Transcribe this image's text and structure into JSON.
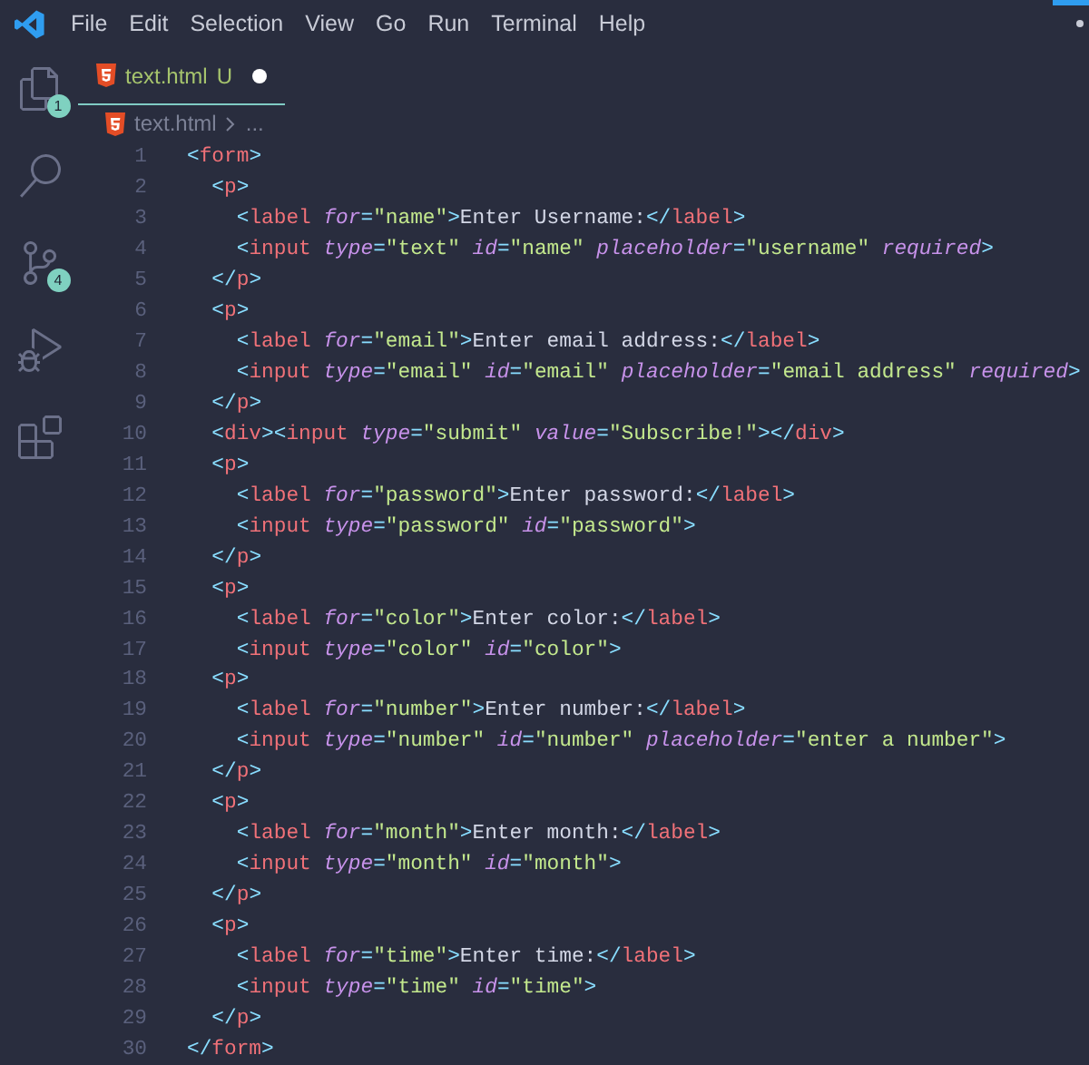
{
  "menu": [
    "File",
    "Edit",
    "Selection",
    "View",
    "Go",
    "Run",
    "Terminal",
    "Help"
  ],
  "activity_bar": [
    {
      "kind": "files",
      "badge": "1"
    },
    {
      "kind": "search"
    },
    {
      "kind": "source-control",
      "badge": "4"
    },
    {
      "kind": "run-debug"
    },
    {
      "kind": "extensions"
    }
  ],
  "tab": {
    "filename": "text.html",
    "status": "U",
    "modified": true,
    "selected": true
  },
  "breadcrumb": [
    "text.html",
    "..."
  ],
  "lines": [
    {
      "number": "1",
      "tokens": [
        {
          "kind": "punct",
          "text": "<"
        },
        {
          "kind": "tag",
          "text": "form"
        },
        {
          "kind": "punct",
          "text": ">"
        }
      ]
    },
    {
      "number": "2",
      "tokens": [
        {
          "kind": "punct",
          "text": "  <"
        },
        {
          "kind": "tag",
          "text": "p"
        },
        {
          "kind": "punct",
          "text": ">"
        }
      ]
    },
    {
      "number": "3",
      "tokens": [
        {
          "kind": "punct",
          "text": "    <"
        },
        {
          "kind": "tag",
          "text": "label"
        },
        {
          "kind": "attr",
          "text": " for"
        },
        {
          "kind": "punct",
          "text": "="
        },
        {
          "kind": "string",
          "text": "\"name\""
        },
        {
          "kind": "punct",
          "text": ">"
        },
        {
          "kind": "text",
          "text": "Enter Username:"
        },
        {
          "kind": "punct",
          "text": "</"
        },
        {
          "kind": "tag",
          "text": "label"
        },
        {
          "kind": "punct",
          "text": ">"
        }
      ]
    },
    {
      "number": "4",
      "tokens": [
        {
          "kind": "punct",
          "text": "    <"
        },
        {
          "kind": "tag",
          "text": "input"
        },
        {
          "kind": "attr",
          "text": " type"
        },
        {
          "kind": "punct",
          "text": "="
        },
        {
          "kind": "string",
          "text": "\"text\""
        },
        {
          "kind": "attr",
          "text": " id"
        },
        {
          "kind": "punct",
          "text": "="
        },
        {
          "kind": "string",
          "text": "\"name\""
        },
        {
          "kind": "attr",
          "text": " placeholder"
        },
        {
          "kind": "punct",
          "text": "="
        },
        {
          "kind": "string",
          "text": "\"username\""
        },
        {
          "kind": "attr",
          "text": " required"
        },
        {
          "kind": "punct",
          "text": ">"
        }
      ]
    },
    {
      "number": "5",
      "tokens": [
        {
          "kind": "punct",
          "text": "  </"
        },
        {
          "kind": "tag",
          "text": "p"
        },
        {
          "kind": "punct",
          "text": ">"
        }
      ]
    },
    {
      "number": "6",
      "tokens": [
        {
          "kind": "punct",
          "text": "  <"
        },
        {
          "kind": "tag",
          "text": "p"
        },
        {
          "kind": "punct",
          "text": ">"
        }
      ]
    },
    {
      "number": "7",
      "tokens": [
        {
          "kind": "punct",
          "text": "    <"
        },
        {
          "kind": "tag",
          "text": "label"
        },
        {
          "kind": "attr",
          "text": " for"
        },
        {
          "kind": "punct",
          "text": "="
        },
        {
          "kind": "string",
          "text": "\"email\""
        },
        {
          "kind": "punct",
          "text": ">"
        },
        {
          "kind": "text",
          "text": "Enter email address:"
        },
        {
          "kind": "punct",
          "text": "</"
        },
        {
          "kind": "tag",
          "text": "label"
        },
        {
          "kind": "punct",
          "text": ">"
        }
      ]
    },
    {
      "number": "8",
      "tokens": [
        {
          "kind": "punct",
          "text": "    <"
        },
        {
          "kind": "tag",
          "text": "input"
        },
        {
          "kind": "attr",
          "text": " type"
        },
        {
          "kind": "punct",
          "text": "="
        },
        {
          "kind": "string",
          "text": "\"email\""
        },
        {
          "kind": "attr",
          "text": " id"
        },
        {
          "kind": "punct",
          "text": "="
        },
        {
          "kind": "string",
          "text": "\"email\""
        },
        {
          "kind": "attr",
          "text": " placeholder"
        },
        {
          "kind": "punct",
          "text": "="
        },
        {
          "kind": "string",
          "text": "\"email address\""
        },
        {
          "kind": "attr",
          "text": " required"
        },
        {
          "kind": "punct",
          "text": ">"
        }
      ]
    },
    {
      "number": "9",
      "tokens": [
        {
          "kind": "punct",
          "text": "  </"
        },
        {
          "kind": "tag",
          "text": "p"
        },
        {
          "kind": "punct",
          "text": ">"
        }
      ]
    },
    {
      "number": "10",
      "tokens": [
        {
          "kind": "punct",
          "text": "  <"
        },
        {
          "kind": "tag",
          "text": "div"
        },
        {
          "kind": "punct",
          "text": "><"
        },
        {
          "kind": "tag",
          "text": "input"
        },
        {
          "kind": "attr",
          "text": " type"
        },
        {
          "kind": "punct",
          "text": "="
        },
        {
          "kind": "string",
          "text": "\"submit\""
        },
        {
          "kind": "attr",
          "text": " value"
        },
        {
          "kind": "punct",
          "text": "="
        },
        {
          "kind": "string",
          "text": "\"Subscribe!\""
        },
        {
          "kind": "punct",
          "text": "></"
        },
        {
          "kind": "tag",
          "text": "div"
        },
        {
          "kind": "punct",
          "text": ">"
        }
      ]
    },
    {
      "number": "11",
      "tokens": [
        {
          "kind": "punct",
          "text": "  <"
        },
        {
          "kind": "tag",
          "text": "p"
        },
        {
          "kind": "punct",
          "text": ">"
        }
      ]
    },
    {
      "number": "12",
      "tokens": [
        {
          "kind": "punct",
          "text": "    <"
        },
        {
          "kind": "tag",
          "text": "label"
        },
        {
          "kind": "attr",
          "text": " for"
        },
        {
          "kind": "punct",
          "text": "="
        },
        {
          "kind": "string",
          "text": "\"password\""
        },
        {
          "kind": "punct",
          "text": ">"
        },
        {
          "kind": "text",
          "text": "Enter password:"
        },
        {
          "kind": "punct",
          "text": "</"
        },
        {
          "kind": "tag",
          "text": "label"
        },
        {
          "kind": "punct",
          "text": ">"
        }
      ]
    },
    {
      "number": "13",
      "tokens": [
        {
          "kind": "punct",
          "text": "    <"
        },
        {
          "kind": "tag",
          "text": "input"
        },
        {
          "kind": "attr",
          "text": " type"
        },
        {
          "kind": "punct",
          "text": "="
        },
        {
          "kind": "string",
          "text": "\"password\""
        },
        {
          "kind": "attr",
          "text": " id"
        },
        {
          "kind": "punct",
          "text": "="
        },
        {
          "kind": "string",
          "text": "\"password\""
        },
        {
          "kind": "punct",
          "text": ">"
        }
      ]
    },
    {
      "number": "14",
      "tokens": [
        {
          "kind": "punct",
          "text": "  </"
        },
        {
          "kind": "tag",
          "text": "p"
        },
        {
          "kind": "punct",
          "text": ">"
        }
      ]
    },
    {
      "number": "15",
      "tokens": [
        {
          "kind": "punct",
          "text": "  <"
        },
        {
          "kind": "tag",
          "text": "p"
        },
        {
          "kind": "punct",
          "text": ">"
        }
      ]
    },
    {
      "number": "16",
      "tokens": [
        {
          "kind": "punct",
          "text": "    <"
        },
        {
          "kind": "tag",
          "text": "label"
        },
        {
          "kind": "attr",
          "text": " for"
        },
        {
          "kind": "punct",
          "text": "="
        },
        {
          "kind": "string",
          "text": "\"color\""
        },
        {
          "kind": "punct",
          "text": ">"
        },
        {
          "kind": "text",
          "text": "Enter color:"
        },
        {
          "kind": "punct",
          "text": "</"
        },
        {
          "kind": "tag",
          "text": "label"
        },
        {
          "kind": "punct",
          "text": ">"
        }
      ]
    },
    {
      "number": "17",
      "tokens": [
        {
          "kind": "punct",
          "text": "    <"
        },
        {
          "kind": "tag",
          "text": "input"
        },
        {
          "kind": "attr",
          "text": " type"
        },
        {
          "kind": "punct",
          "text": "="
        },
        {
          "kind": "string",
          "text": "\"color\""
        },
        {
          "kind": "attr",
          "text": " id"
        },
        {
          "kind": "punct",
          "text": "="
        },
        {
          "kind": "string",
          "text": "\"color\""
        },
        {
          "kind": "punct",
          "text": ">"
        }
      ]
    },
    {
      "number": "18",
      "tokens": [
        {
          "kind": "punct",
          "text": "  <"
        },
        {
          "kind": "tag",
          "text": "p"
        },
        {
          "kind": "punct",
          "text": ">"
        }
      ]
    },
    {
      "number": "19",
      "tokens": [
        {
          "kind": "punct",
          "text": "    <"
        },
        {
          "kind": "tag",
          "text": "label"
        },
        {
          "kind": "attr",
          "text": " for"
        },
        {
          "kind": "punct",
          "text": "="
        },
        {
          "kind": "string",
          "text": "\"number\""
        },
        {
          "kind": "punct",
          "text": ">"
        },
        {
          "kind": "text",
          "text": "Enter number:"
        },
        {
          "kind": "punct",
          "text": "</"
        },
        {
          "kind": "tag",
          "text": "label"
        },
        {
          "kind": "punct",
          "text": ">"
        }
      ]
    },
    {
      "number": "20",
      "tokens": [
        {
          "kind": "punct",
          "text": "    <"
        },
        {
          "kind": "tag",
          "text": "input"
        },
        {
          "kind": "attr",
          "text": " type"
        },
        {
          "kind": "punct",
          "text": "="
        },
        {
          "kind": "string",
          "text": "\"number\""
        },
        {
          "kind": "attr",
          "text": " id"
        },
        {
          "kind": "punct",
          "text": "="
        },
        {
          "kind": "string",
          "text": "\"number\""
        },
        {
          "kind": "attr",
          "text": " placeholder"
        },
        {
          "kind": "punct",
          "text": "="
        },
        {
          "kind": "string",
          "text": "\"enter a number\""
        },
        {
          "kind": "punct",
          "text": ">"
        }
      ]
    },
    {
      "number": "21",
      "tokens": [
        {
          "kind": "punct",
          "text": "  </"
        },
        {
          "kind": "tag",
          "text": "p"
        },
        {
          "kind": "punct",
          "text": ">"
        }
      ]
    },
    {
      "number": "22",
      "tokens": [
        {
          "kind": "punct",
          "text": "  <"
        },
        {
          "kind": "tag",
          "text": "p"
        },
        {
          "kind": "punct",
          "text": ">"
        }
      ]
    },
    {
      "number": "23",
      "tokens": [
        {
          "kind": "punct",
          "text": "    <"
        },
        {
          "kind": "tag",
          "text": "label"
        },
        {
          "kind": "attr",
          "text": " for"
        },
        {
          "kind": "punct",
          "text": "="
        },
        {
          "kind": "string",
          "text": "\"month\""
        },
        {
          "kind": "punct",
          "text": ">"
        },
        {
          "kind": "text",
          "text": "Enter month:"
        },
        {
          "kind": "punct",
          "text": "</"
        },
        {
          "kind": "tag",
          "text": "label"
        },
        {
          "kind": "punct",
          "text": ">"
        }
      ]
    },
    {
      "number": "24",
      "tokens": [
        {
          "kind": "punct",
          "text": "    <"
        },
        {
          "kind": "tag",
          "text": "input"
        },
        {
          "kind": "attr",
          "text": " type"
        },
        {
          "kind": "punct",
          "text": "="
        },
        {
          "kind": "string",
          "text": "\"month\""
        },
        {
          "kind": "attr",
          "text": " id"
        },
        {
          "kind": "punct",
          "text": "="
        },
        {
          "kind": "string",
          "text": "\"month\""
        },
        {
          "kind": "punct",
          "text": ">"
        }
      ]
    },
    {
      "number": "25",
      "tokens": [
        {
          "kind": "punct",
          "text": "  </"
        },
        {
          "kind": "tag",
          "text": "p"
        },
        {
          "kind": "punct",
          "text": ">"
        }
      ]
    },
    {
      "number": "26",
      "tokens": [
        {
          "kind": "punct",
          "text": "  <"
        },
        {
          "kind": "tag",
          "text": "p"
        },
        {
          "kind": "punct",
          "text": ">"
        }
      ]
    },
    {
      "number": "27",
      "tokens": [
        {
          "kind": "punct",
          "text": "    <"
        },
        {
          "kind": "tag",
          "text": "label"
        },
        {
          "kind": "attr",
          "text": " for"
        },
        {
          "kind": "punct",
          "text": "="
        },
        {
          "kind": "string",
          "text": "\"time\""
        },
        {
          "kind": "punct",
          "text": ">"
        },
        {
          "kind": "text",
          "text": "Enter time:"
        },
        {
          "kind": "punct",
          "text": "</"
        },
        {
          "kind": "tag",
          "text": "label"
        },
        {
          "kind": "punct",
          "text": ">"
        }
      ]
    },
    {
      "number": "28",
      "tokens": [
        {
          "kind": "punct",
          "text": "    <"
        },
        {
          "kind": "tag",
          "text": "input"
        },
        {
          "kind": "attr",
          "text": " type"
        },
        {
          "kind": "punct",
          "text": "="
        },
        {
          "kind": "string",
          "text": "\"time\""
        },
        {
          "kind": "attr",
          "text": " id"
        },
        {
          "kind": "punct",
          "text": "="
        },
        {
          "kind": "string",
          "text": "\"time\""
        },
        {
          "kind": "punct",
          "text": ">"
        }
      ]
    },
    {
      "number": "29",
      "tokens": [
        {
          "kind": "punct",
          "text": "  </"
        },
        {
          "kind": "tag",
          "text": "p"
        },
        {
          "kind": "punct",
          "text": ">"
        }
      ]
    },
    {
      "number": "30",
      "tokens": [
        {
          "kind": "punct",
          "text": "</"
        },
        {
          "kind": "tag",
          "text": "form"
        },
        {
          "kind": "punct",
          "text": ">"
        }
      ]
    }
  ]
}
